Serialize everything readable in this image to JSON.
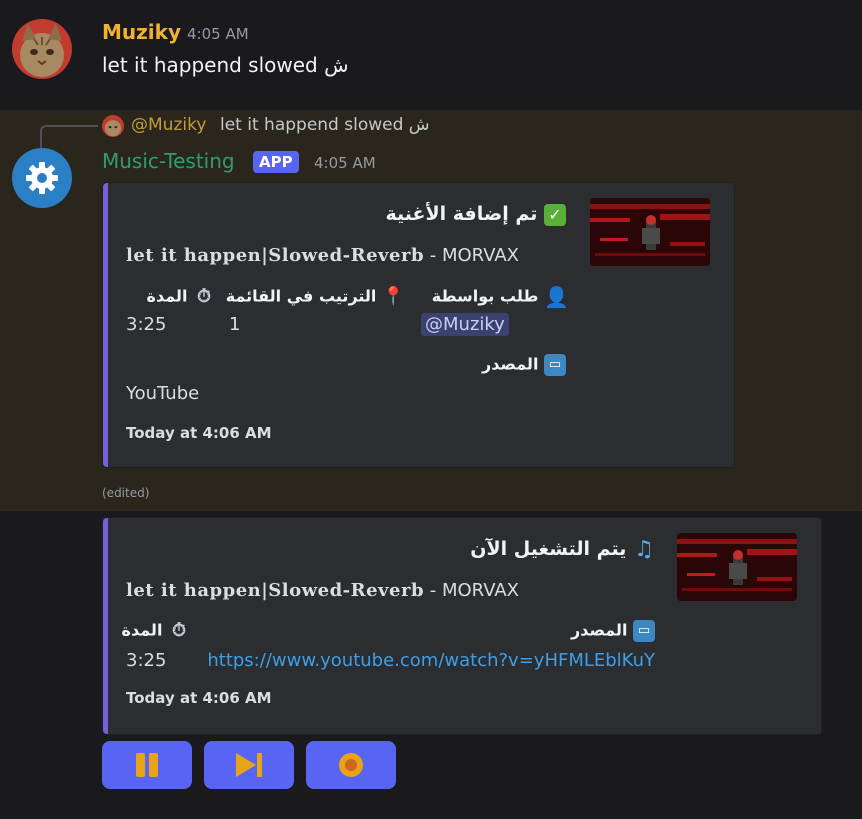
{
  "message1": {
    "username": "Muziky",
    "timestamp": "4:05 AM",
    "text": "let it happend slowed ش"
  },
  "message2": {
    "reply": {
      "mention": "@Muziky",
      "text": "let it happend slowed ش"
    },
    "bot_name": "Music-Testing",
    "badge": "APP",
    "timestamp": "4:05 AM",
    "edited_label": "(edited)",
    "embed": {
      "title": "تم إضافة الأغنية",
      "song_title": "let it happen|Slowed-Reverb",
      "artist": " - MORVAX",
      "fields": {
        "requested_by_label": "طلب بواسطة",
        "requested_by_value": "@Muziky",
        "position_label": "الترتيب في القائمة",
        "position_value": "1",
        "duration_label": "المدة",
        "duration_value": "3:25",
        "source_label": "المصدر",
        "source_value": "YouTube"
      },
      "footer": "Today at 4:06 AM"
    }
  },
  "now_playing": {
    "title": "يتم التشغيل الآن",
    "song_title": "let it happen|Slowed-Reverb",
    "artist": " - MORVAX",
    "fields": {
      "source_label": "المصدر",
      "source_value": "https://www.youtube.com/watch?v=yHFMLEblKuY",
      "duration_label": "المدة",
      "duration_value": "3:25"
    },
    "footer": "Today at 4:06 AM"
  },
  "controls": [
    {
      "icon": "pause-icon"
    },
    {
      "icon": "skip-icon"
    },
    {
      "icon": "stop-icon"
    }
  ],
  "colors": {
    "username": "#f0b232",
    "bot_name": "#2f9e6e",
    "badge": "#5865f2",
    "embed_bar": "#7561d8",
    "link": "#3e9fe6",
    "button": "#5865f2",
    "control_icon": "#e8a317"
  }
}
